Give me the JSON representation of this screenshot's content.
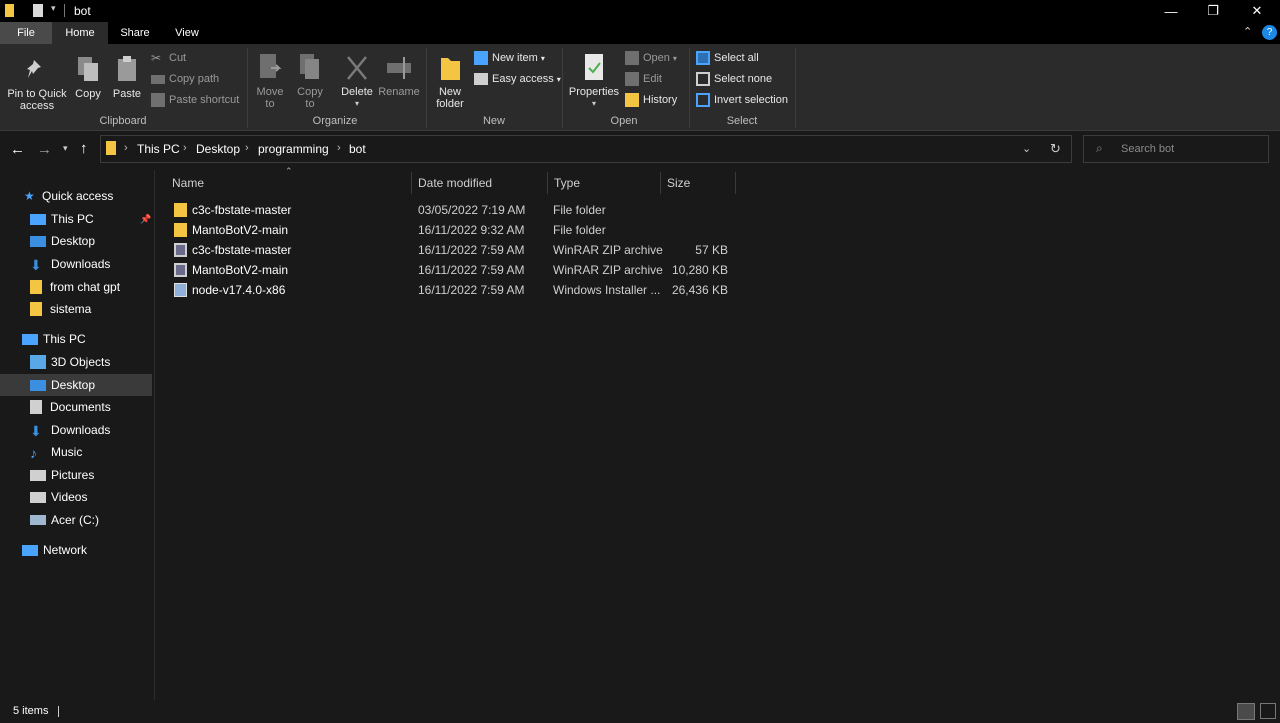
{
  "window": {
    "title": "bot",
    "minimize": "—",
    "restore": "❐",
    "close": "✕"
  },
  "tabs": [
    "File",
    "Home",
    "Share",
    "View"
  ],
  "ribbon": {
    "clipboard": {
      "pin_label": "Pin to Quick access",
      "copy_label": "Copy",
      "paste_label": "Paste",
      "cut_label": "Cut",
      "copy_path_label": "Copy path",
      "paste_shortcut_label": "Paste shortcut",
      "group_label": "Clipboard"
    },
    "organize": {
      "move_to_label": "Move to",
      "copy_to_label": "Copy to",
      "delete_label": "Delete",
      "rename_label": "Rename",
      "group_label": "Organize"
    },
    "new": {
      "new_folder_label": "New folder",
      "new_item_label": "New item",
      "easy_access_label": "Easy access",
      "group_label": "New"
    },
    "open": {
      "properties_label": "Properties",
      "open_label": "Open",
      "edit_label": "Edit",
      "history_label": "History",
      "group_label": "Open"
    },
    "select": {
      "select_all_label": "Select all",
      "select_none_label": "Select none",
      "invert_label": "Invert selection",
      "group_label": "Select"
    }
  },
  "address": {
    "crumbs": [
      "This PC",
      "Desktop",
      "programming",
      "bot"
    ],
    "search_placeholder": "Search bot"
  },
  "nav": {
    "quick_access": "Quick access",
    "quick_items": [
      "This PC",
      "Desktop",
      "Downloads",
      "from chat gpt",
      "sistema"
    ],
    "this_pc": "This PC",
    "pc_items": [
      "3D Objects",
      "Desktop",
      "Documents",
      "Downloads",
      "Music",
      "Pictures",
      "Videos",
      "Acer (C:)"
    ],
    "network": "Network",
    "selected": "Desktop"
  },
  "columns": {
    "name": "Name",
    "date": "Date modified",
    "type": "Type",
    "size": "Size"
  },
  "files": [
    {
      "name": "c3c-fbstate-master",
      "date": "03/05/2022 7:19 AM",
      "type": "File folder",
      "size": "",
      "icon": "folder-icon"
    },
    {
      "name": "MantoBotV2-main",
      "date": "16/11/2022 9:32 AM",
      "type": "File folder",
      "size": "",
      "icon": "folder-icon"
    },
    {
      "name": "c3c-fbstate-master",
      "date": "16/11/2022 7:59 AM",
      "type": "WinRAR ZIP archive",
      "size": "57 KB",
      "icon": "zip-icon"
    },
    {
      "name": "MantoBotV2-main",
      "date": "16/11/2022 7:59 AM",
      "type": "WinRAR ZIP archive",
      "size": "10,280 KB",
      "icon": "zip-icon"
    },
    {
      "name": "node-v17.4.0-x86",
      "date": "16/11/2022 7:59 AM",
      "type": "Windows Installer ...",
      "size": "26,436 KB",
      "icon": "installer-icon"
    }
  ],
  "status": {
    "count": "5 items"
  },
  "colors": {
    "folder": "#f4c542",
    "accent": "#0078d7",
    "background": "#191919",
    "ribbon": "#2b2b2b"
  }
}
